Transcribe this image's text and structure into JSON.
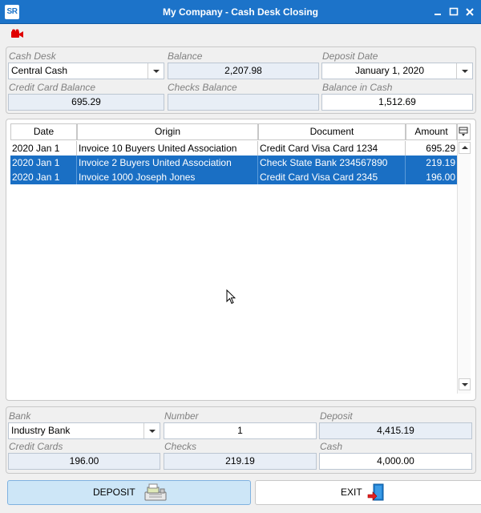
{
  "window": {
    "logo": "SR",
    "title": "My Company - Cash Desk Closing"
  },
  "header": {
    "cash_desk": {
      "label": "Cash Desk",
      "value": "Central Cash"
    },
    "balance": {
      "label": "Balance",
      "value": "2,207.98"
    },
    "deposit_date": {
      "label": "Deposit Date",
      "value": "January 1, 2020"
    },
    "credit_card_balance": {
      "label": "Credit Card Balance",
      "value": "695.29"
    },
    "checks_balance": {
      "label": "Checks Balance",
      "value": ""
    },
    "balance_in_cash": {
      "label": "Balance in Cash",
      "value": "1,512.69"
    }
  },
  "grid": {
    "columns": [
      "Date",
      "Origin",
      "Document",
      "Amount"
    ],
    "rows": [
      {
        "date": "2020 Jan 1",
        "origin": "Invoice 10 Buyers United Association",
        "document": "Credit Card Visa Card 1234",
        "amount": "695.29",
        "selected": false
      },
      {
        "date": "2020 Jan 1",
        "origin": "Invoice 2 Buyers United Association",
        "document": "Check State Bank 234567890",
        "amount": "219.19",
        "selected": true
      },
      {
        "date": "2020 Jan 1",
        "origin": "Invoice 1000 Joseph Jones",
        "document": "Credit Card Visa Card 2345",
        "amount": "196.00",
        "selected": true
      }
    ]
  },
  "footer": {
    "bank": {
      "label": "Bank",
      "value": "Industry Bank"
    },
    "number": {
      "label": "Number",
      "value": "1"
    },
    "deposit": {
      "label": "Deposit",
      "value": "4,415.19"
    },
    "credit_cards": {
      "label": "Credit Cards",
      "value": "196.00"
    },
    "checks": {
      "label": "Checks",
      "value": "219.19"
    },
    "cash": {
      "label": "Cash",
      "value": "4,000.00"
    }
  },
  "buttons": {
    "deposit": "DEPOSIT",
    "exit": "EXIT"
  },
  "icons": {
    "app": "sr-logo-icon",
    "record": "video-camera-icon",
    "minimize": "minimize-icon",
    "maximize": "maximize-icon",
    "close": "close-icon",
    "deposit": "cash-register-icon",
    "exit": "exit-door-icon",
    "column_chooser": "column-chooser-icon"
  },
  "colors": {
    "titlebar": "#1c73c9",
    "selection": "#1a6fc4",
    "readonly_field": "#e8eef6",
    "deposit_button": "#cde6f7"
  }
}
